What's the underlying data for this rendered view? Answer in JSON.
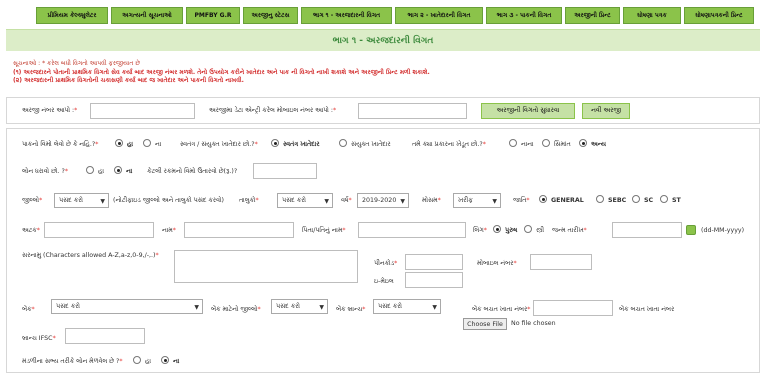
{
  "nav": [
    "પ્રીમિયમ કેલ્ક્યુલેટર",
    "અગત્યની સૂચનાઓ",
    "PMFBY G.R",
    "અરજીનુ સ્ટેટસ",
    "ભાગ ૧ - અરજદારની વિગત",
    "ભાગ ૨ - ખાતેદારની વિગત",
    "ભાગ ૩ - પાકની વિગત",
    "અરજીની પ્રિન્ટ",
    "ઘોષણા પત્રક",
    "ઘોષણાપત્રકની પ્રિન્ટ"
  ],
  "banner_title": "ભાગ ૧ - અરજદારની વિગત",
  "notes": {
    "heading": "સૂચનાઓ : * કરેલ બધી વિગતો આપવી ફરજીયાત છે",
    "line1": "(૧) અરજદારને પોતાની પ્રાથમિક વિગતો સેવ કર્યા બાદ અરજી નંબર મળશે. તેનો ઉપયોગ કરીને ખાતેદાર અને પાક ની વિગતો નાખી શકાશે અને અરજીની પ્રિન્ટ મળી શકાશે.",
    "line2": "(૨) અરજદારની પ્રાથમિક વિગતોની ચકાસણી કર્યા બાદ જ ખાતેદાર અને પાકની વિગતો નાખવી."
  },
  "app_search": {
    "app_no_label": "અરજી નંબર આપો :",
    "mobile_label": "અરજીમા ડેટા એન્ટ્રી કરેલ મોબાઇલ નંબર આપો :",
    "edit_button": "અરજીની વિગતો સુધારવા",
    "new_button": "નવી અરજી"
  },
  "insured": {
    "label": "પાકનો વિમો લેવો છે કે નહિ.?",
    "yes": "હા",
    "no": "ના"
  },
  "ownership": {
    "label": "સ્વતંત્ર / સંયુક્ત ખાતેદાર છો.?",
    "own": "સ્વતંત્ર ખાતેદાર",
    "joint": "સંયુક્ત ખાતેદાર"
  },
  "farmer_type": {
    "label": "તમે ક્યા પ્રકારના ખેડૂત છો.?",
    "small": "નાના",
    "marginal": "સિમાંત",
    "other": "અન્ય"
  },
  "loan": {
    "label": "લોન ધરાવો છો. ?",
    "yes": "હા",
    "no": "ના",
    "amount_label": "કેટલી રકમનો વિમો ઉતારવો છે(રૂ.)?"
  },
  "location": {
    "district_label": "જીલ્લો",
    "district_value": "પસંદ કરો",
    "district_note": "(નોટીફાઇડ જીલ્લો અને તાલુકો પસંદ કરવો)",
    "taluka_label": "તાલુકો",
    "taluka_value": "પસંદ કરો",
    "year_label": "વર્ષ",
    "year_value": "2019-2020",
    "season_label": "મોસમ",
    "season_value": "ખરીફ",
    "caste_label": "જાતિ",
    "castes": [
      "GENERAL",
      "SEBC",
      "SC",
      "ST"
    ]
  },
  "name": {
    "surname_label": "અટક",
    "name_label": "નામ",
    "father_label": "પિતા/પતિનું નામ",
    "gender_label": "લિંગ",
    "male": "પુરુષ",
    "female": "સ્ત્રી",
    "dob_label": "જન્મ તારીખ",
    "dob_format": "(dd-MM-yyyy)"
  },
  "address": {
    "label": "સરનામુ (Characters allowed A-Z,a-z,0-9,/-,.)",
    "pincode_label": "પીનકોડ",
    "mobile_label": "મોબાઇલ નંબર",
    "email_label": "ઇ-મેઇલ"
  },
  "bank": {
    "bank_label": "બેંક",
    "bank_value": "પસંદ કરો",
    "bank_district_label": "બેંક માટેનો જીલ્લો",
    "bank_district_value": "પસંદ કરો",
    "branch_label": "બેંક બ્રાન્ચ",
    "branch_value": "પસંદ કરો",
    "acc_label": "બેંક બચત ખાતા નંબર",
    "acc_label2": "બેંક બચત ખાતા નંબર",
    "choose_file": "Choose File",
    "no_file": "No file chosen",
    "ifsc_label": "બ્રાન્ચ IFSC"
  },
  "mandali": {
    "label": "મંડળીના સભ્ય તરીકે લોન મેળવેલ છે ?",
    "yes": "હા",
    "no": "ના"
  }
}
